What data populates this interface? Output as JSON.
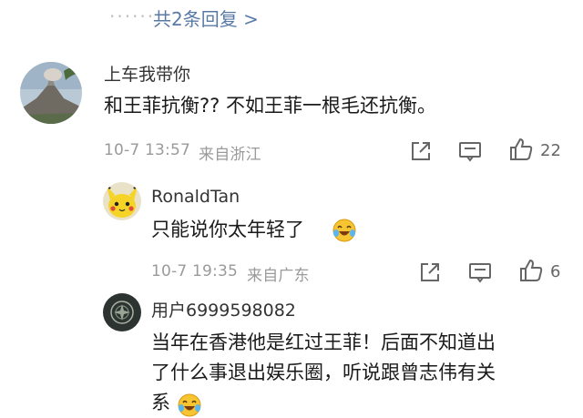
{
  "thread_top": {
    "reply_count_link": "共2条回复 >"
  },
  "comments": [
    {
      "username": "上车我带你",
      "text": "和王菲抗衡?? 不如王菲一根毛还抗衡。",
      "time": "10-7 13:57",
      "location": "来自浙江",
      "like_count": "22",
      "avatar_icon": "volcano-avatar-icon"
    },
    {
      "username": "RonaldTan",
      "text": "只能说你太年轻了",
      "emoji": "laughing-crying-emoji",
      "time": "10-7 19:35",
      "location": "来自广东",
      "like_count": "6",
      "avatar_icon": "pikachu-avatar-icon"
    },
    {
      "username": "用户6999598082",
      "text_line1": "当年在香港他是红过王菲！后面不知道出",
      "text_line2": "了什么事退出娱乐圈，听说跟曾志伟有关",
      "text_line3": "系",
      "emoji": "laughing-crying-emoji",
      "avatar_icon": "dark-badge-avatar-icon"
    }
  ],
  "colors": {
    "link": "#5a7aa6",
    "muted": "#9a9a9a",
    "text": "#1a1a1a",
    "icon": "#666666"
  }
}
